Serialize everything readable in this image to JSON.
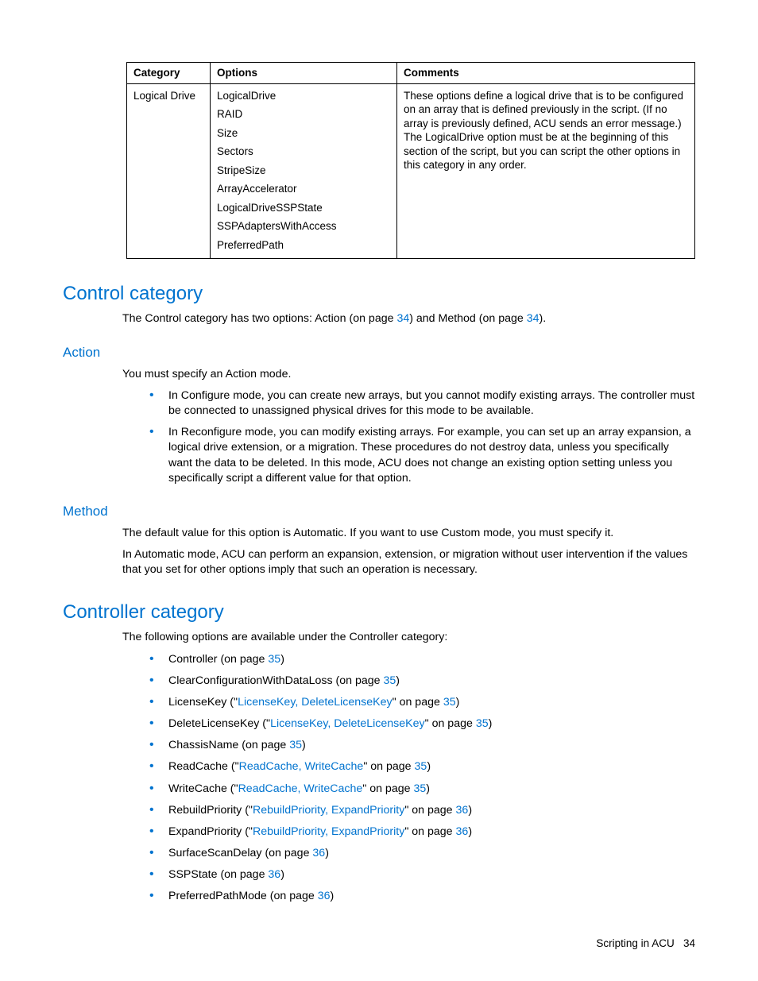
{
  "table": {
    "headers": [
      "Category",
      "Options",
      "Comments"
    ],
    "row": {
      "category": "Logical Drive",
      "options": [
        "LogicalDrive",
        "RAID",
        "Size",
        "Sectors",
        "StripeSize",
        "ArrayAccelerator",
        "LogicalDriveSSPState",
        "SSPAdaptersWithAccess",
        "PreferredPath"
      ],
      "comments": "These options define a logical drive that is to be configured on an array that is defined previously in the script. (If no array is previously defined, ACU sends an error message.) The LogicalDrive option must be at the beginning of this section of the script, but you can script the other options in this category in any order."
    }
  },
  "control": {
    "heading": "Control category",
    "intro_pre": "The Control category has two options: Action (on page ",
    "intro_p1": "34",
    "intro_mid": ") and Method (on page ",
    "intro_p2": "34",
    "intro_post": ")."
  },
  "action": {
    "heading": "Action",
    "intro": "You must specify an Action mode.",
    "b1": "In Configure mode, you can create new arrays, but you cannot modify existing arrays. The controller must be connected to unassigned physical drives for this mode to be available.",
    "b2": "In Reconfigure mode, you can modify existing arrays. For example, you can set up an array expansion, a logical drive extension, or a migration. These procedures do not destroy data, unless you specifically want the data to be deleted. In this mode, ACU does not change an existing option setting unless you specifically script a different value for that option."
  },
  "method": {
    "heading": "Method",
    "p1": "The default value for this option is Automatic. If you want to use Custom mode, you must specify it.",
    "p2": "In Automatic mode, ACU can perform an expansion, extension, or migration without user intervention if the values that you set for other options imply that such an operation is necessary."
  },
  "controller": {
    "heading": "Controller category",
    "intro": "The following options are available under the Controller category:",
    "items": {
      "i0": {
        "pre": "Controller (on page ",
        "link": "35",
        "post": ")"
      },
      "i1": {
        "pre": "ClearConfigurationWithDataLoss (on page ",
        "link": "35",
        "post": ")"
      },
      "i2": {
        "pre": "LicenseKey (\"",
        "link1": "LicenseKey, DeleteLicenseKey",
        "mid": "\" on page ",
        "link2": "35",
        "post": ")"
      },
      "i3": {
        "pre": "DeleteLicenseKey (\"",
        "link1": "LicenseKey, DeleteLicenseKey",
        "mid": "\" on page ",
        "link2": "35",
        "post": ")"
      },
      "i4": {
        "pre": "ChassisName (on page ",
        "link": "35",
        "post": ")"
      },
      "i5": {
        "pre": "ReadCache (\"",
        "link1": "ReadCache, WriteCache",
        "mid": "\" on page ",
        "link2": "35",
        "post": ")"
      },
      "i6": {
        "pre": "WriteCache (\"",
        "link1": "ReadCache, WriteCache",
        "mid": "\" on page ",
        "link2": "35",
        "post": ")"
      },
      "i7": {
        "pre": "RebuildPriority (\"",
        "link1": "RebuildPriority, ExpandPriority",
        "mid": "\" on page ",
        "link2": "36",
        "post": ")"
      },
      "i8": {
        "pre": "ExpandPriority (\"",
        "link1": "RebuildPriority, ExpandPriority",
        "mid": "\" on page ",
        "link2": "36",
        "post": ")"
      },
      "i9": {
        "pre": "SurfaceScanDelay (on page ",
        "link": "36",
        "post": ")"
      },
      "i10": {
        "pre": "SSPState (on page ",
        "link": "36",
        "post": ")"
      },
      "i11": {
        "pre": "PreferredPathMode (on page ",
        "link": "36",
        "post": ")"
      }
    }
  },
  "footer": {
    "text": "Scripting in ACU",
    "page": "34"
  }
}
